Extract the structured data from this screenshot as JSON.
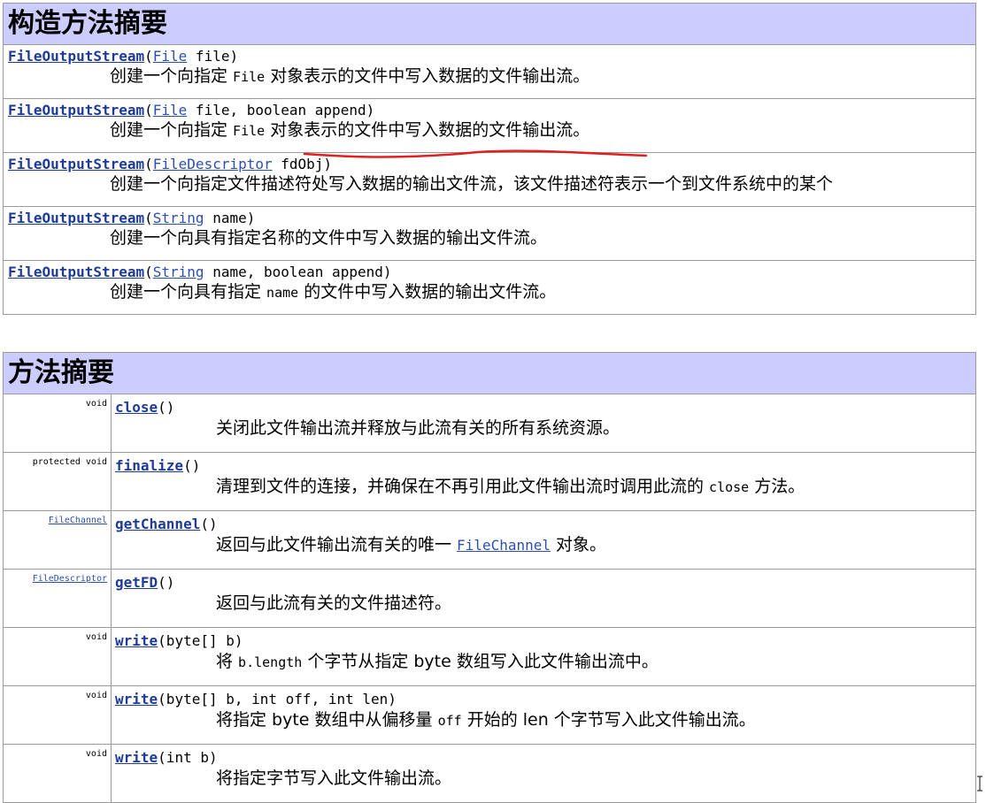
{
  "constructor_summary": {
    "title": "构造方法摘要",
    "rows": [
      {
        "name": "FileOutputStream",
        "open": "(",
        "param_type": "File",
        "params": " file)",
        "desc_parts": [
          "创建一个向指定 ",
          "File",
          " 对象表示的文件中写入数据的文件输出流。"
        ]
      },
      {
        "name": "FileOutputStream",
        "open": "(",
        "param_type": "File",
        "params": " file, boolean append)",
        "desc_parts": [
          "创建一个向指定 ",
          "File",
          " 对象表示的文件中写入数据的文件输出流。"
        ]
      },
      {
        "name": "FileOutputStream",
        "open": "(",
        "param_type": "FileDescriptor",
        "params": " fdObj)",
        "desc_parts": [
          "创建一个向指定文件描述符处写入数据的输出文件流，该文件描述符表示一个到文件系统中的某个",
          "",
          ""
        ]
      },
      {
        "name": "FileOutputStream",
        "open": "(",
        "param_type": "String",
        "params": " name)",
        "desc_parts": [
          "创建一个向具有指定名称的文件中写入数据的输出文件流。",
          "",
          ""
        ]
      },
      {
        "name": "FileOutputStream",
        "open": "(",
        "param_type": "String",
        "params": " name, boolean append)",
        "desc_parts": [
          "创建一个向具有指定 ",
          "name",
          " 的文件中写入数据的输出文件流。"
        ]
      }
    ]
  },
  "method_summary": {
    "title": "方法摘要",
    "rows": [
      {
        "modifier": "void",
        "return_link": "",
        "name": "close",
        "params": "()",
        "desc_parts": [
          "关闭此文件输出流并释放与此流有关的所有系统资源。",
          "",
          ""
        ],
        "desc_link": ""
      },
      {
        "modifier": "protected  void",
        "return_link": "",
        "name": "finalize",
        "params": "()",
        "desc_parts": [
          "清理到文件的连接，并确保在不再引用此文件输出流时调用此流的 ",
          "close",
          " 方法。"
        ],
        "desc_link": ""
      },
      {
        "modifier": "",
        "return_link": "FileChannel",
        "name": "getChannel",
        "params": "()",
        "desc_parts": [
          "返回与此文件输出流有关的唯一 ",
          "",
          " 对象。"
        ],
        "desc_link": "FileChannel"
      },
      {
        "modifier": "",
        "return_link": "FileDescriptor",
        "name": "getFD",
        "params": "()",
        "desc_parts": [
          "返回与此流有关的文件描述符。",
          "",
          ""
        ],
        "desc_link": ""
      },
      {
        "modifier": "void",
        "return_link": "",
        "name": "write",
        "params": "(byte[] b)",
        "desc_parts": [
          "将 ",
          "b.length",
          " 个字节从指定 byte 数组写入此文件输出流中。"
        ],
        "desc_link": ""
      },
      {
        "modifier": "void",
        "return_link": "",
        "name": "write",
        "params": "(byte[] b, int off, int len)",
        "desc_parts": [
          "将指定 byte 数组中从偏移量 ",
          "off",
          " 开始的 len 个字节写入此文件输出流。"
        ],
        "desc_link": ""
      },
      {
        "modifier": "void",
        "return_link": "",
        "name": "write",
        "params": "(int b)",
        "desc_parts": [
          "将指定字节写入此文件输出流。",
          "",
          ""
        ],
        "desc_link": ""
      }
    ]
  },
  "colors": {
    "header_bg": "#ccccff",
    "link": "#2c4fb0",
    "annotation": "#e02020"
  }
}
